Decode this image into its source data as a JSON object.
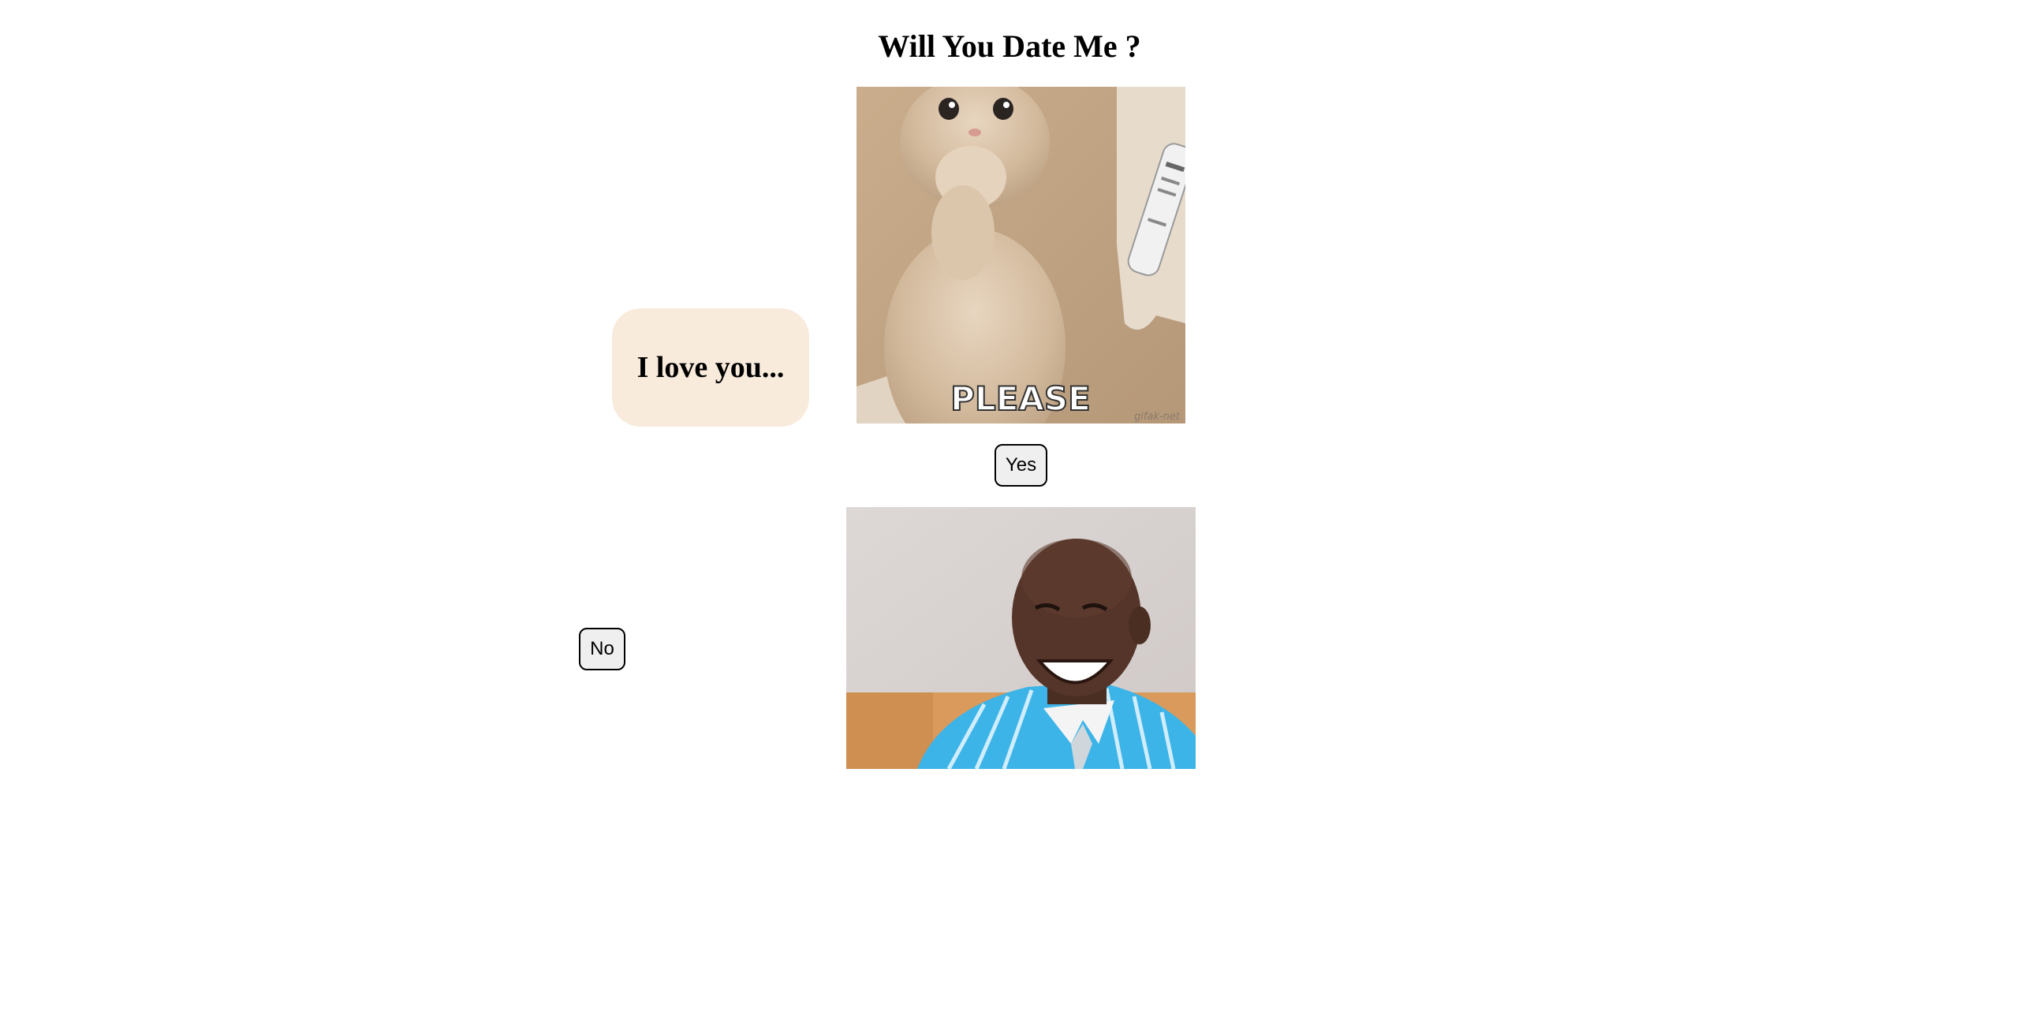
{
  "page": {
    "title": "Will You Date Me ?"
  },
  "bubble": {
    "text": "I love you..."
  },
  "cat_gif": {
    "caption": "PLEASE",
    "watermark": "gifak-net"
  },
  "buttons": {
    "yes_label": "Yes",
    "no_label": "No"
  },
  "colors": {
    "bubble_bg": "#f8ebdc",
    "button_bg": "#efefef",
    "shirt_blue": "#3cb4e8"
  }
}
